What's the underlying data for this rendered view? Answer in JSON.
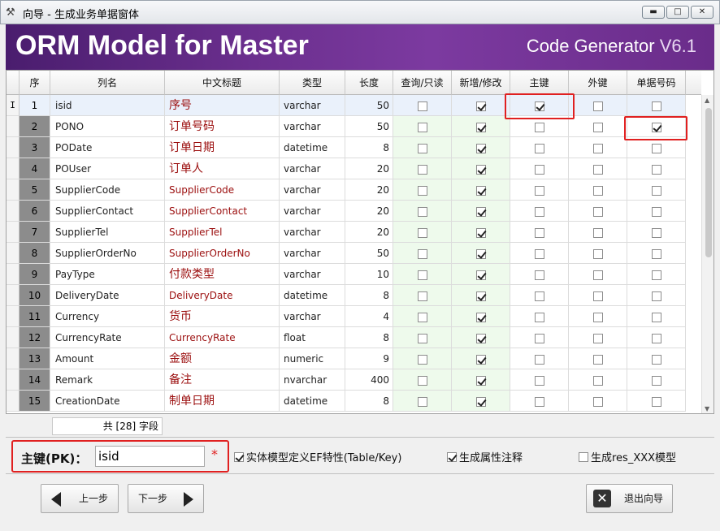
{
  "window": {
    "title": "向导 - 生成业务单据窗体",
    "btn_min": "▬",
    "btn_max": "□",
    "btn_close": "✕"
  },
  "banner": {
    "title": "ORM Model for Master",
    "subtitle": "Code Generator",
    "version": "V6.1"
  },
  "grid": {
    "headers": [
      "序",
      "列名",
      "中文标题",
      "类型",
      "长度",
      "查询/只读",
      "新增/修改",
      "主键",
      "外键",
      "单据号码"
    ],
    "rows": [
      {
        "idx": "1",
        "name": "isid",
        "cn": "序号",
        "type": "varchar",
        "len": "50",
        "query": false,
        "edit": true,
        "pk": true,
        "fk": false,
        "docno": false
      },
      {
        "idx": "2",
        "name": "PONO",
        "cn": "订单号码",
        "type": "varchar",
        "len": "50",
        "query": false,
        "edit": true,
        "pk": false,
        "fk": false,
        "docno": true
      },
      {
        "idx": "3",
        "name": "PODate",
        "cn": "订单日期",
        "type": "datetime",
        "len": "8",
        "query": false,
        "edit": true,
        "pk": false,
        "fk": false,
        "docno": false
      },
      {
        "idx": "4",
        "name": "POUser",
        "cn": "订单人",
        "type": "varchar",
        "len": "20",
        "query": false,
        "edit": true,
        "pk": false,
        "fk": false,
        "docno": false
      },
      {
        "idx": "5",
        "name": "SupplierCode",
        "cn": "SupplierCode",
        "type": "varchar",
        "len": "20",
        "query": false,
        "edit": true,
        "pk": false,
        "fk": false,
        "docno": false
      },
      {
        "idx": "6",
        "name": "SupplierContact",
        "cn": "SupplierContact",
        "type": "varchar",
        "len": "20",
        "query": false,
        "edit": true,
        "pk": false,
        "fk": false,
        "docno": false
      },
      {
        "idx": "7",
        "name": "SupplierTel",
        "cn": "SupplierTel",
        "type": "varchar",
        "len": "20",
        "query": false,
        "edit": true,
        "pk": false,
        "fk": false,
        "docno": false
      },
      {
        "idx": "8",
        "name": "SupplierOrderNo",
        "cn": "SupplierOrderNo",
        "type": "varchar",
        "len": "50",
        "query": false,
        "edit": true,
        "pk": false,
        "fk": false,
        "docno": false
      },
      {
        "idx": "9",
        "name": "PayType",
        "cn": "付款类型",
        "type": "varchar",
        "len": "10",
        "query": false,
        "edit": true,
        "pk": false,
        "fk": false,
        "docno": false
      },
      {
        "idx": "10",
        "name": "DeliveryDate",
        "cn": "DeliveryDate",
        "type": "datetime",
        "len": "8",
        "query": false,
        "edit": true,
        "pk": false,
        "fk": false,
        "docno": false
      },
      {
        "idx": "11",
        "name": "Currency",
        "cn": "货币",
        "type": "varchar",
        "len": "4",
        "query": false,
        "edit": true,
        "pk": false,
        "fk": false,
        "docno": false
      },
      {
        "idx": "12",
        "name": "CurrencyRate",
        "cn": "CurrencyRate",
        "type": "float",
        "len": "8",
        "query": false,
        "edit": true,
        "pk": false,
        "fk": false,
        "docno": false
      },
      {
        "idx": "13",
        "name": "Amount",
        "cn": "金额",
        "type": "numeric",
        "len": "9",
        "query": false,
        "edit": true,
        "pk": false,
        "fk": false,
        "docno": false
      },
      {
        "idx": "14",
        "name": "Remark",
        "cn": "备注",
        "type": "nvarchar",
        "len": "400",
        "query": false,
        "edit": true,
        "pk": false,
        "fk": false,
        "docno": false
      },
      {
        "idx": "15",
        "name": "CreationDate",
        "cn": "制单日期",
        "type": "datetime",
        "len": "8",
        "query": false,
        "edit": true,
        "pk": false,
        "fk": false,
        "docno": false
      }
    ],
    "row_indicator": "I",
    "field_count": "共 [28] 字段"
  },
  "options": {
    "pk_label": "主键(PK)：",
    "pk_value": "isid",
    "required_mark": "*",
    "ef_attr_label": "实体模型定义EF特性(Table/Key)",
    "ef_attr_checked": true,
    "prop_comment_label": "生成属性注释",
    "prop_comment_checked": true,
    "res_model_label": "生成res_XXX模型",
    "res_model_checked": false
  },
  "buttons": {
    "prev": "上一步",
    "next": "下一步",
    "exit": "退出向导"
  }
}
